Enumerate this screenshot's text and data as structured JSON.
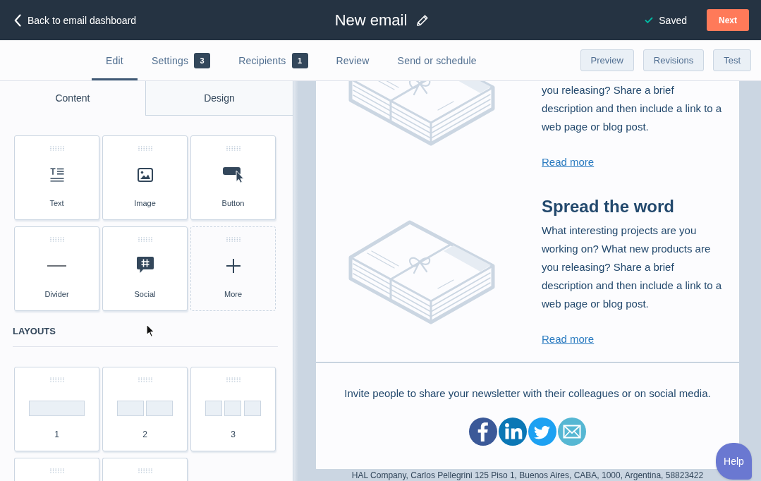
{
  "top_bar": {
    "back_link": "Back to email dashboard",
    "title": "New email",
    "save_status": "Saved",
    "next_button": "Next"
  },
  "nav": {
    "tabs": [
      {
        "label": "Edit",
        "selected": true
      },
      {
        "label": "Settings",
        "badge": "3",
        "selected": false
      },
      {
        "label": "Recipients",
        "badge": "1",
        "selected": false
      },
      {
        "label": "Review",
        "selected": false
      },
      {
        "label": "Send or schedule",
        "selected": false
      }
    ],
    "buttons": [
      "Preview",
      "Revisions",
      "Test"
    ]
  },
  "sidebar": {
    "tabs": [
      {
        "label": "Content",
        "selected": true
      },
      {
        "label": "Design",
        "selected": false
      }
    ],
    "modules": [
      {
        "label": "Text",
        "kind": "text"
      },
      {
        "label": "Image",
        "kind": "image"
      },
      {
        "label": "Button",
        "kind": "button"
      },
      {
        "label": "Divider",
        "kind": "divider"
      },
      {
        "label": "Social",
        "kind": "social"
      },
      {
        "label": "More",
        "kind": "more"
      }
    ],
    "layouts_heading": "LAYOUTS",
    "layouts": [
      {
        "label": "1",
        "kind": "one-column"
      },
      {
        "label": "2",
        "kind": "two-column"
      },
      {
        "label": "3",
        "kind": "three-column"
      },
      {
        "kind": "cut-off"
      },
      {
        "kind": "cut-off"
      }
    ]
  },
  "email": {
    "articles": [
      {
        "kind": "scrolled",
        "body": "you releasing? Share a brief description and then include a link to a web page or blog post.",
        "link": "Read more"
      },
      {
        "kind": "full",
        "heading": "Spread the word",
        "body": "What interesting projects are you working on? What new products are you releasing? Share a brief description and then include a link to a web page or blog post.",
        "link": "Read more"
      }
    ],
    "share_text": "Invite people to share your newsletter with their colleagues or on social media.",
    "footer": "HAL Company, Carlos Pellegrini 125 Piso 1, Buenos Aires, CABA, 1000, Argentina, 58823422"
  },
  "help_button": "Help"
}
